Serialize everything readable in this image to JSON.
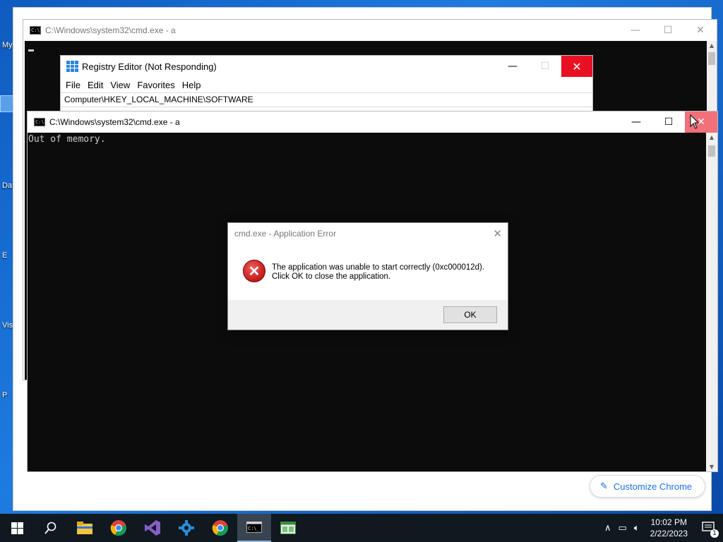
{
  "desktop": {
    "icons": [
      {
        "label": "My"
      },
      {
        "label": "Da"
      },
      {
        "label": "E"
      },
      {
        "label": "Vis"
      },
      {
        "label": "P"
      }
    ]
  },
  "chrome": {
    "customize_label": "Customize Chrome"
  },
  "cmd_back": {
    "title": "C:\\Windows\\system32\\cmd.exe - a"
  },
  "regedit": {
    "title": "Registry Editor (Not Responding)",
    "menu": [
      "File",
      "Edit",
      "View",
      "Favorites",
      "Help"
    ],
    "address": "Computer\\HKEY_LOCAL_MACHINE\\SOFTWARE"
  },
  "cmd_front": {
    "title": "C:\\Windows\\system32\\cmd.exe - a",
    "output": "Out of memory."
  },
  "dialog": {
    "title": "cmd.exe - Application Error",
    "message_line1": "The application was unable to start correctly (0xc000012d).",
    "message_line2": "Click OK to close the application.",
    "ok_label": "OK"
  },
  "taskbar": {
    "time": "10:02 PM",
    "date": "2/22/2023",
    "notification_count": "1"
  }
}
